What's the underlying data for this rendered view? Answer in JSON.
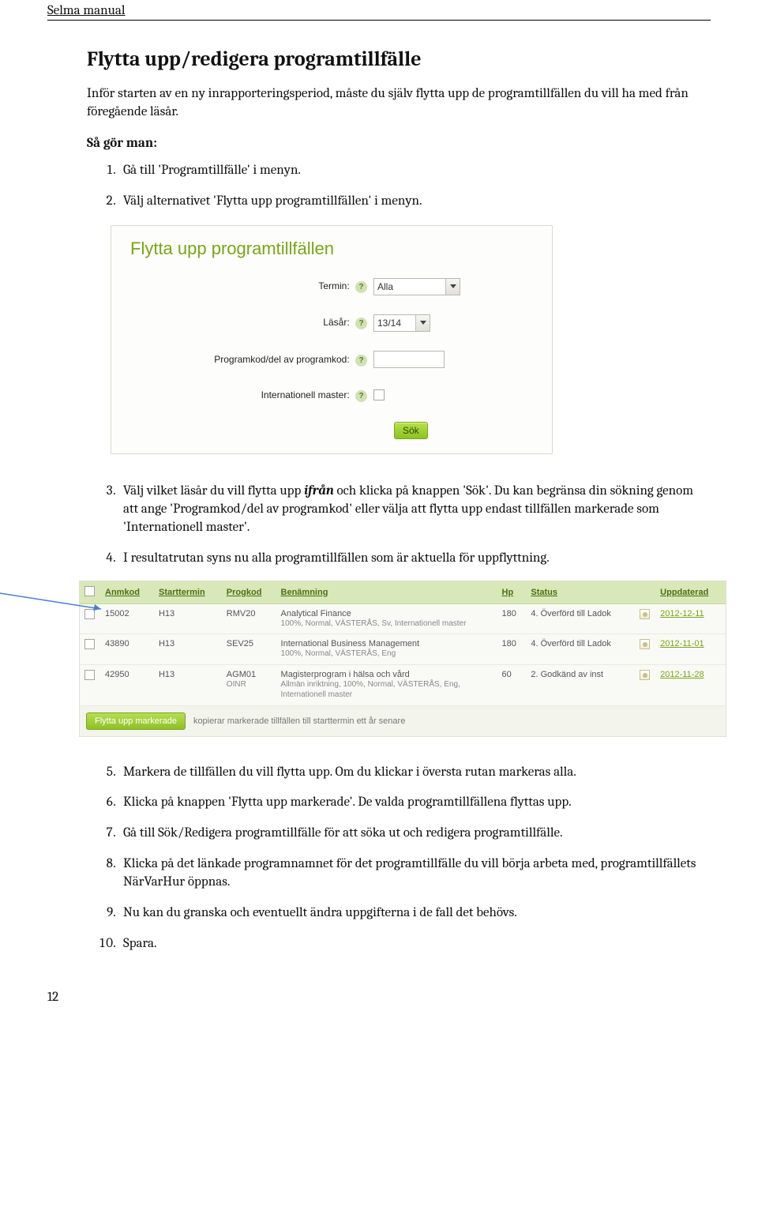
{
  "doc_header": "Selma manual",
  "title": "Flytta upp/redigera programtillfälle",
  "intro": "Inför starten av en ny inrapporteringsperiod, måste du själv flytta upp de programtillfällen du vill ha med från föregående läsår.",
  "subhead": "Så gör man:",
  "steps": {
    "s1": "Gå till 'Programtillfälle' i menyn.",
    "s2": "Välj alternativet 'Flytta upp programtillfällen' i menyn.",
    "s3a": "Välj vilket läsår du vill flytta upp ",
    "s3_em": "ifrån",
    "s3b": " och klicka på knappen 'Sök'. Du kan begränsa din sökning genom att ange 'Programkod/del av programkod' eller välja att flytta upp endast tillfällen markerade som 'Internationell master'.",
    "s4": "I resultatrutan syns nu alla programtillfällen som är aktuella för uppflyttning.",
    "s5": "Markera de tillfällen du vill flytta upp. Om du klickar i översta rutan markeras alla.",
    "s6": "Klicka på knappen 'Flytta upp markerade'. De valda programtillfällena flyttas upp.",
    "s7": "Gå till Sök/Redigera programtillfälle för att söka ut och redigera programtillfälle.",
    "s8": "Klicka på det länkade programnamnet för det programtillfälle du vill börja arbeta med, programtillfällets NärVarHur öppnas.",
    "s9": "Nu kan du granska och eventuellt ändra uppgifterna i de fall det behövs.",
    "s10": "Spara."
  },
  "form": {
    "title": "Flytta upp programtillfällen",
    "termin_label": "Termin:",
    "termin_value": "Alla",
    "lasar_label": "Läsår:",
    "lasar_value": "13/14",
    "progkod_label": "Programkod/del av programkod:",
    "intmaster_label": "Internationell master:",
    "sok_btn": "Sök"
  },
  "table": {
    "headers": {
      "anmkod": "Anmkod",
      "starttermin": "Starttermin",
      "progkod": "Progkod",
      "benamning": "Benämning",
      "hp": "Hp",
      "status": "Status",
      "uppdaterad": "Uppdaterad"
    },
    "rows": [
      {
        "anmkod": "15002",
        "start": "H13",
        "prog": "RMV20",
        "name": "Analytical Finance",
        "sub": "100%, Normal, VÄSTERÅS, Sv, Internationell master",
        "hp": "180",
        "status": "4. Överförd till Ladok",
        "date": "2012-12-11"
      },
      {
        "anmkod": "43890",
        "start": "H13",
        "prog": "SEV25",
        "name": "International Business Management",
        "sub": "100%, Normal, VÄSTERÅS, Eng",
        "hp": "180",
        "status": "4. Överförd till Ladok",
        "date": "2012-11-01"
      },
      {
        "anmkod": "42950",
        "start": "H13",
        "prog": "AGM01",
        "prog2": "OINR",
        "name": "Magisterprogram i hälsa och vård",
        "sub": "Allmän inriktning, 100%, Normal, VÄSTERÅS, Eng, Internationell master",
        "hp": "60",
        "status": "2. Godkänd av inst",
        "date": "2012-11-28"
      }
    ],
    "footer_btn": "Flytta upp markerade",
    "footer_text": "kopierar markerade tillfällen till starttermin ett år senare"
  },
  "page_num": "12"
}
